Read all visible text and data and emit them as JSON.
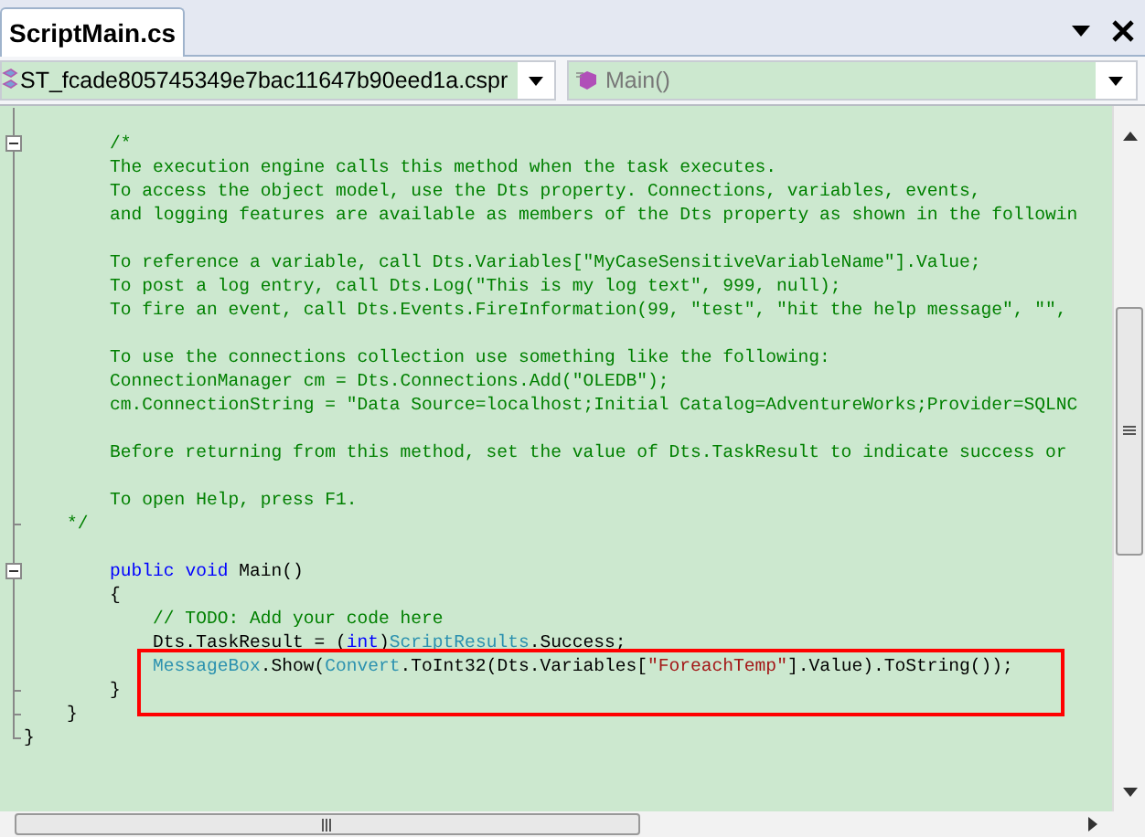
{
  "tab": {
    "title": "ScriptMain.cs",
    "selected": true
  },
  "type_dropdown": {
    "value": "ST_fcade805745349e7bac11647b90eed1a.cspr"
  },
  "member_dropdown": {
    "value": "Main()"
  },
  "lines": [
    {
      "kind": "line"
    },
    {
      "kind": "box",
      "tokens": [
        {
          "kind": "comment",
          "text": "        /*"
        }
      ]
    },
    {
      "kind": "line",
      "tokens": [
        {
          "kind": "comment",
          "text": "        The execution engine calls this method when the task executes."
        }
      ]
    },
    {
      "kind": "line",
      "tokens": [
        {
          "kind": "comment",
          "text": "        To access the object model, use the Dts property. Connections, variables, events,"
        }
      ]
    },
    {
      "kind": "line",
      "tokens": [
        {
          "kind": "comment",
          "text": "        and logging features are available as members of the Dts property as shown in the followin"
        }
      ]
    },
    {
      "kind": "line"
    },
    {
      "kind": "line",
      "tokens": [
        {
          "kind": "comment",
          "text": "        To reference a variable, call Dts.Variables[\"MyCaseSensitiveVariableName\"].Value;"
        }
      ]
    },
    {
      "kind": "line",
      "tokens": [
        {
          "kind": "comment",
          "text": "        To post a log entry, call Dts.Log(\"This is my log text\", 999, null);"
        }
      ]
    },
    {
      "kind": "line",
      "tokens": [
        {
          "kind": "comment",
          "text": "        To fire an event, call Dts.Events.FireInformation(99, \"test\", \"hit the help message\", \"\","
        }
      ]
    },
    {
      "kind": "line"
    },
    {
      "kind": "line",
      "tokens": [
        {
          "kind": "comment",
          "text": "        To use the connections collection use something like the following:"
        }
      ]
    },
    {
      "kind": "line",
      "tokens": [
        {
          "kind": "comment",
          "text": "        ConnectionManager cm = Dts.Connections.Add(\"OLEDB\");"
        }
      ]
    },
    {
      "kind": "line",
      "tokens": [
        {
          "kind": "comment",
          "text": "        cm.ConnectionString = \"Data Source=localhost;Initial Catalog=AdventureWorks;Provider=SQLNC"
        }
      ]
    },
    {
      "kind": "line"
    },
    {
      "kind": "line",
      "tokens": [
        {
          "kind": "comment",
          "text": "        Before returning from this method, set the value of Dts.TaskResult to indicate success or"
        }
      ]
    },
    {
      "kind": "line"
    },
    {
      "kind": "line",
      "tokens": [
        {
          "kind": "comment",
          "text": "        To open Help, press F1."
        }
      ]
    },
    {
      "kind": "end",
      "tokens": [
        {
          "kind": "comment",
          "text": "    */"
        }
      ]
    },
    {
      "kind": "line"
    },
    {
      "kind": "box",
      "tokens": [
        {
          "kind": "keyword",
          "text": "        public"
        },
        {
          "kind": "keyword",
          "text": " void"
        },
        {
          "kind": "plain",
          "text": " Main()"
        }
      ]
    },
    {
      "kind": "line",
      "tokens": [
        {
          "kind": "plain",
          "text": "        {"
        }
      ]
    },
    {
      "kind": "line",
      "tokens": [
        {
          "kind": "comment",
          "text": "            // TODO: Add your code here"
        }
      ]
    },
    {
      "kind": "line",
      "tokens": [
        {
          "kind": "plain",
          "text": "            Dts.TaskResult = ("
        },
        {
          "kind": "keyword",
          "text": "int"
        },
        {
          "kind": "plain",
          "text": ")"
        },
        {
          "kind": "type",
          "text": "ScriptResults"
        },
        {
          "kind": "plain",
          "text": ".Success;"
        }
      ]
    },
    {
      "kind": "line",
      "tokens": [
        {
          "kind": "type",
          "text": "            MessageBox"
        },
        {
          "kind": "plain",
          "text": ".Show("
        },
        {
          "kind": "type",
          "text": "Convert"
        },
        {
          "kind": "plain",
          "text": ".ToInt32(Dts.Variables["
        },
        {
          "kind": "string",
          "text": "\"ForeachTemp\""
        },
        {
          "kind": "plain",
          "text": "].Value).ToString());"
        }
      ]
    },
    {
      "kind": "end",
      "tokens": [
        {
          "kind": "plain",
          "text": "        }"
        }
      ]
    },
    {
      "kind": "end",
      "tokens": [
        {
          "kind": "plain",
          "text": "    }"
        }
      ]
    },
    {
      "kind": "corner",
      "tokens": [
        {
          "kind": "plain",
          "text": "}"
        }
      ]
    }
  ],
  "annotation": {
    "kind": "rectangle"
  }
}
